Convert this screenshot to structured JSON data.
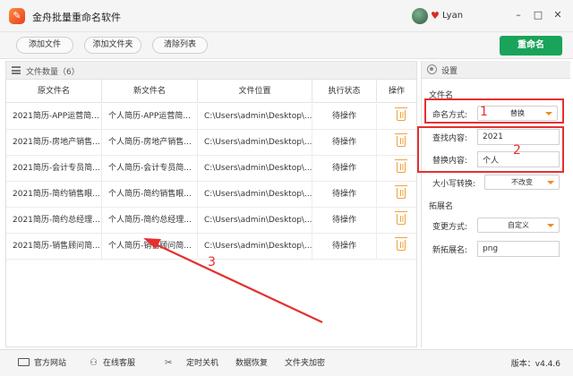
{
  "window": {
    "logo_char": "✎",
    "title": "金舟批量重命名软件",
    "user": "Lyan",
    "minimize": "–",
    "restore": "□",
    "close": "✕"
  },
  "toolbar": {
    "add_file": "添加文件",
    "add_folder": "添加文件夹",
    "clear_list": "清除列表",
    "rename": "重命名"
  },
  "file_list": {
    "count_label": "文件数量（6）",
    "columns": [
      "原文件名",
      "新文件名",
      "文件位置",
      "执行状态",
      "操作"
    ],
    "rows": [
      [
        "2021简历-APP运营简...",
        "个人简历-APP运营简...",
        "C:\\Users\\admin\\Desktop\\...",
        "待操作"
      ],
      [
        "2021简历-房地产销售...",
        "个人简历-房地产销售...",
        "C:\\Users\\admin\\Desktop\\...",
        "待操作"
      ],
      [
        "2021简历-会计专员简...",
        "个人简历-会计专员简...",
        "C:\\Users\\admin\\Desktop\\...",
        "待操作"
      ],
      [
        "2021简历-简约销售眼...",
        "个人简历-简约销售眼...",
        "C:\\Users\\admin\\Desktop\\...",
        "待操作"
      ],
      [
        "2021简历-简约总经理...",
        "个人简历-简约总经理...",
        "C:\\Users\\admin\\Desktop\\...",
        "待操作"
      ],
      [
        "2021简历-销售顾问简...",
        "个人简历-销售顾问简...",
        "C:\\Users\\admin\\Desktop\\...",
        "待操作"
      ]
    ]
  },
  "settings": {
    "title": "设置",
    "filename_section": "文件名",
    "naming_mode_label": "命名方式:",
    "naming_mode_value": "替换",
    "find_label": "查找内容:",
    "find_value": "2021",
    "replace_label": "替换内容:",
    "replace_value": "个人",
    "case_label": "大小写转换:",
    "case_value": "不改变",
    "ext_section": "拓展名",
    "change_mode_label": "变更方式:",
    "change_mode_value": "自定义",
    "new_ext_label": "新拓展名:",
    "new_ext_value": "png"
  },
  "annotations": {
    "n1": "1",
    "n2": "2",
    "n3": "3"
  },
  "statusbar": {
    "website": "官方网站",
    "support": "在线客服",
    "timer_shutdown": "定时关机",
    "data_recovery": "数据恢复",
    "folder_encrypt": "文件夹加密",
    "version": "版本：v4.4.6"
  },
  "colors": {
    "accent_green": "#1aa35a",
    "annotation_red": "#e53030",
    "trash_orange": "#f0a23a"
  }
}
